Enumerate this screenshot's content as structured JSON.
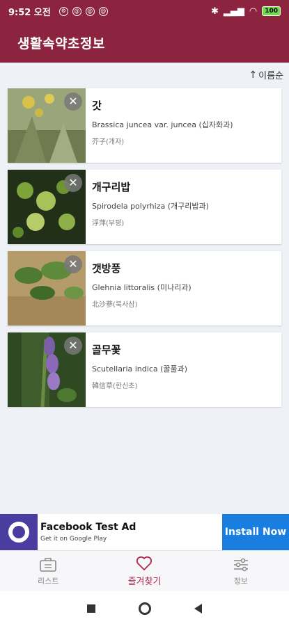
{
  "status_bar": {
    "time": "9:52 오전",
    "battery": "100"
  },
  "app": {
    "title": "생활속약초정보"
  },
  "sort": {
    "label": "이름순",
    "arrow": "↑"
  },
  "cards": [
    {
      "name": "갓",
      "scientific": "Brassica juncea var. juncea (십자화과)",
      "hanja": "芥子(개자)"
    },
    {
      "name": "개구리밥",
      "scientific": "Spirodela polyrhiza (개구리밥과)",
      "hanja": "浮萍(부평)"
    },
    {
      "name": "갯방풍",
      "scientific": "Glehnia littoralis (미나리과)",
      "hanja": "北沙蔘(북사삼)"
    },
    {
      "name": "골무꽃",
      "scientific": "Scutellaria indica (꿀풀과)",
      "hanja": "韓信草(한신초)"
    }
  ],
  "ad": {
    "title": "Facebook Test Ad",
    "subtitle": "Get it on Google Play",
    "button": "Install Now"
  },
  "bottom_nav": [
    {
      "label": "리스트",
      "icon": "briefcase-icon"
    },
    {
      "label": "즐겨찾기",
      "icon": "heart-icon",
      "active": true
    },
    {
      "label": "정보",
      "icon": "sliders-icon"
    }
  ],
  "colors": {
    "primary": "#8c2440",
    "accent": "#b0264d",
    "ad_button": "#1a7de0"
  }
}
